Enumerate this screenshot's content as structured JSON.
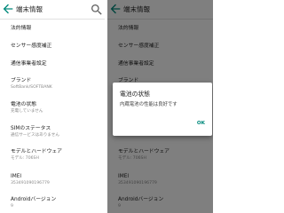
{
  "accent_color": "#00897b",
  "left_screen": {
    "title": "端末情報",
    "back_icon": "arrow-back-icon",
    "search_icon": "search-icon",
    "items": [
      {
        "title": "法的情報",
        "subtitle": ""
      },
      {
        "title": "センサー感度補正",
        "subtitle": ""
      },
      {
        "title": "通信事業者設定",
        "subtitle": ""
      },
      {
        "title": "ブランド",
        "subtitle": "SoftBank/SOFTBANK"
      },
      {
        "title": "電池の状態",
        "subtitle": "充電していません"
      },
      {
        "title": "SIMのステータス",
        "subtitle": "通信サービスはありません"
      },
      {
        "title": "モデルとハードウェア",
        "subtitle": "モデル: 706SH"
      },
      {
        "title": "IMEI",
        "subtitle": "353491090196779"
      },
      {
        "title": "Androidバージョン",
        "subtitle": "9"
      }
    ]
  },
  "right_screen": {
    "title": "端末情報",
    "back_icon": "arrow-back-icon",
    "items": [
      {
        "title": "法的情報",
        "subtitle": ""
      },
      {
        "title": "センサー感度補正",
        "subtitle": ""
      },
      {
        "title": "通信事業者設定",
        "subtitle": ""
      },
      {
        "title": "ブランド",
        "subtitle": ""
      },
      {
        "title": "モデルとハードウェア",
        "subtitle": "モデル: 706SH"
      },
      {
        "title": "IMEI",
        "subtitle": "353491090196779"
      },
      {
        "title": "Androidバージョン",
        "subtitle": "9"
      }
    ],
    "dialog": {
      "title": "電池の状態",
      "message": "内蔵電池の性能は良好です",
      "ok_label": "OK"
    }
  }
}
